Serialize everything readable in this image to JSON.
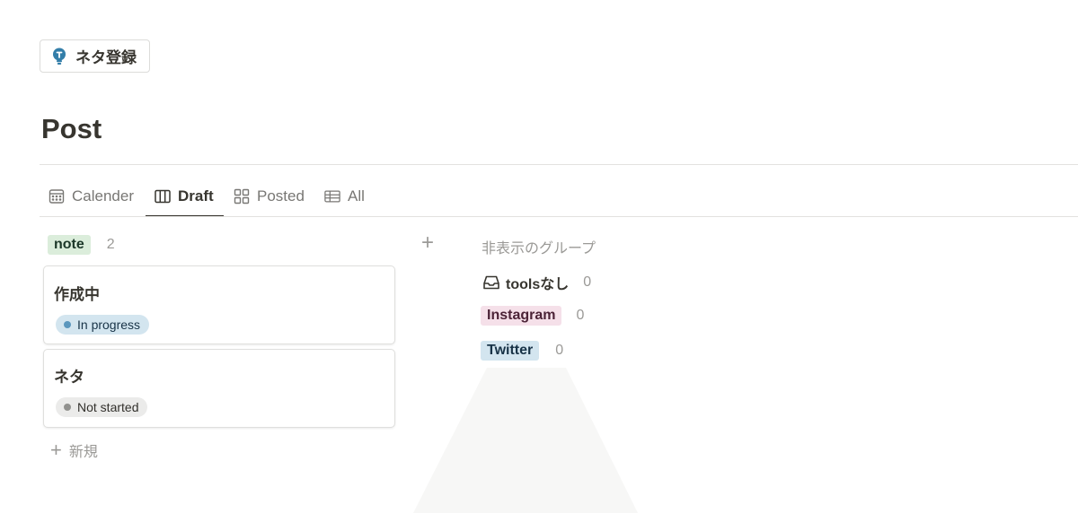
{
  "top_button": {
    "label": "ネタ登録",
    "icon": "lightbulb-icon",
    "icon_color": "#337ea9"
  },
  "page": {
    "title": "Post"
  },
  "tabs": [
    {
      "label": "Calender",
      "icon": "calendar-icon"
    },
    {
      "label": "Draft",
      "icon": "board-icon",
      "active": true
    },
    {
      "label": "Posted",
      "icon": "gallery-icon"
    },
    {
      "label": "All",
      "icon": "table-icon"
    }
  ],
  "board": {
    "group": {
      "label": "note",
      "count": "2",
      "bg": "#dbeddb",
      "color": "#1c3829"
    },
    "cards": [
      {
        "title": "作成中",
        "status": "In progress",
        "status_bg": "#d3e5ef",
        "dot": "#5b97bd"
      },
      {
        "title": "ネタ",
        "status": "Not started",
        "status_bg": "#ebebea",
        "dot": "#91918e"
      }
    ],
    "new_label": "新規",
    "add_group_icon": "plus-icon"
  },
  "hidden_groups": {
    "title": "非表示のグループ",
    "items": [
      {
        "label": "toolsなし",
        "count": "0",
        "icon": "inbox-icon"
      },
      {
        "label": "Instagram",
        "count": "0",
        "bg": "#f5e0e9",
        "color": "#4c2337"
      },
      {
        "label": "Twitter",
        "count": "0",
        "bg": "#d3e5ef",
        "color": "#183347"
      }
    ]
  }
}
